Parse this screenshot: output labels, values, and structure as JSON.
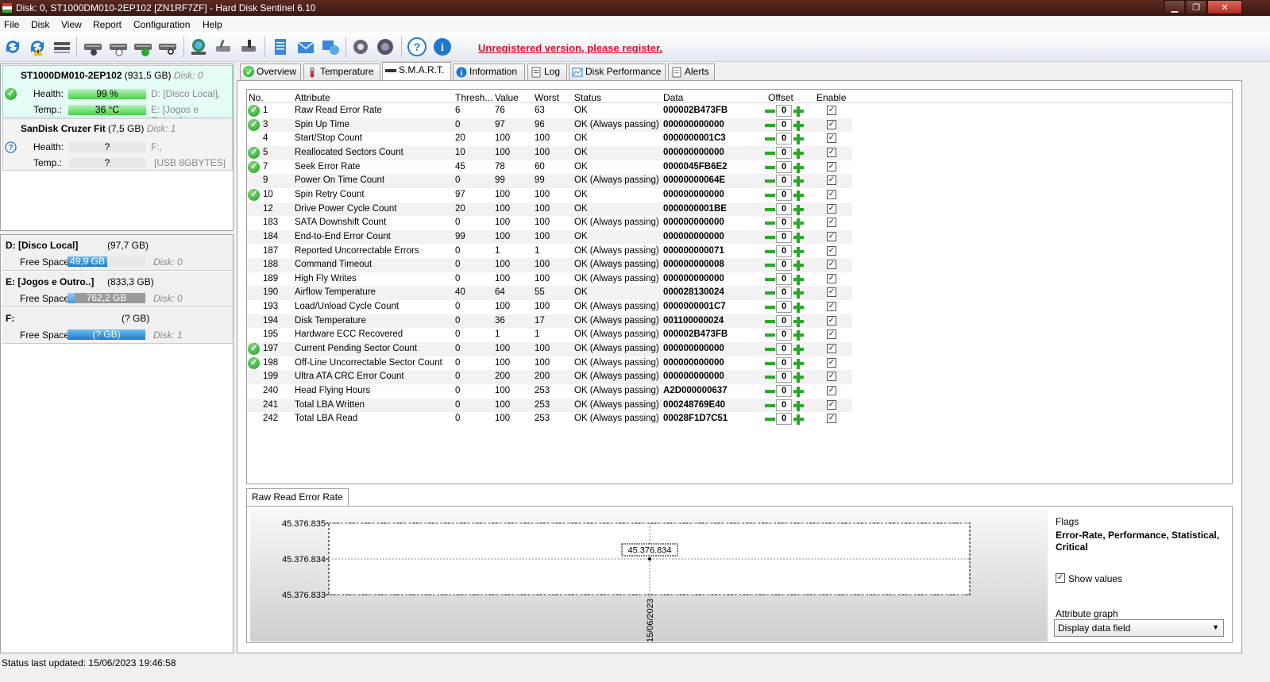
{
  "window": {
    "title": "Disk: 0, ST1000DM010-2EP102 [ZN1RF7ZF]  -  Hard Disk Sentinel 6.10"
  },
  "menu": [
    "File",
    "Disk",
    "View",
    "Report",
    "Configuration",
    "Help"
  ],
  "toolbar": {
    "register_text": "Unregistered version, please register."
  },
  "disks": [
    {
      "name": "ST1000DM010-2EP102",
      "capacity": "(931,5 GB)",
      "disk": "Disk: 0",
      "health_label": "Health:",
      "health": "99 %",
      "health_pct": 99,
      "temp_label": "Temp.:",
      "temp": "36 °C",
      "drive1": "D: [Disco Local],",
      "drive2": "E: [Jogos e Outros],"
    },
    {
      "name": "SanDisk Cruzer Fit",
      "capacity": "(7,5 GB)",
      "disk": "Disk: 1",
      "health_label": "Health:",
      "health": "?",
      "temp_label": "Temp.:",
      "temp": "?",
      "drive1": "F:,",
      "drive2": "[USB 8GBYTES]"
    }
  ],
  "volumes": [
    {
      "name": "D: [Disco Local]",
      "capacity": "(97,7 GB)",
      "free_label": "Free Space",
      "free": "49,9 GB",
      "free_pct": 51,
      "disk": "Disk: 0"
    },
    {
      "name": "E: [Jogos e Outro..]",
      "capacity": "(833,3 GB)",
      "free_label": "Free Space",
      "free": "762,2 GB",
      "free_pct": 9,
      "disk": "Disk: 0"
    },
    {
      "name": "F:",
      "capacity": "(? GB)",
      "free_label": "Free Space",
      "free": "(? GB)",
      "free_pct": 100,
      "disk": "Disk: 1"
    }
  ],
  "tabs": [
    "Overview",
    "Temperature",
    "S.M.A.R.T.",
    "Information",
    "Log",
    "Disk Performance",
    "Alerts"
  ],
  "smart": {
    "headers": {
      "no": "No.",
      "attribute": "Attribute",
      "threshold": "Thresh...",
      "value": "Value",
      "worst": "Worst",
      "status": "Status",
      "data": "Data",
      "offset": "Offset",
      "enable": "Enable"
    },
    "rows": [
      {
        "ok": true,
        "no": "1",
        "attr": "Raw Read Error Rate",
        "th": "6",
        "val": "76",
        "worst": "63",
        "status": "OK",
        "data": "000002B473FB",
        "offset": "0"
      },
      {
        "ok": true,
        "no": "3",
        "attr": "Spin Up Time",
        "th": "0",
        "val": "97",
        "worst": "96",
        "status": "OK (Always passing)",
        "data": "000000000000",
        "offset": "0"
      },
      {
        "ok": false,
        "no": "4",
        "attr": "Start/Stop Count",
        "th": "20",
        "val": "100",
        "worst": "100",
        "status": "OK",
        "data": "0000000001C3",
        "offset": "0"
      },
      {
        "ok": true,
        "no": "5",
        "attr": "Reallocated Sectors Count",
        "th": "10",
        "val": "100",
        "worst": "100",
        "status": "OK",
        "data": "000000000000",
        "offset": "0"
      },
      {
        "ok": true,
        "no": "7",
        "attr": "Seek Error Rate",
        "th": "45",
        "val": "78",
        "worst": "60",
        "status": "OK",
        "data": "0000045FB6E2",
        "offset": "0"
      },
      {
        "ok": false,
        "no": "9",
        "attr": "Power On Time Count",
        "th": "0",
        "val": "99",
        "worst": "99",
        "status": "OK (Always passing)",
        "data": "00000000064E",
        "offset": "0"
      },
      {
        "ok": true,
        "no": "10",
        "attr": "Spin Retry Count",
        "th": "97",
        "val": "100",
        "worst": "100",
        "status": "OK",
        "data": "000000000000",
        "offset": "0"
      },
      {
        "ok": false,
        "no": "12",
        "attr": "Drive Power Cycle Count",
        "th": "20",
        "val": "100",
        "worst": "100",
        "status": "OK",
        "data": "0000000001BE",
        "offset": "0"
      },
      {
        "ok": false,
        "no": "183",
        "attr": "SATA Downshift Count",
        "th": "0",
        "val": "100",
        "worst": "100",
        "status": "OK (Always passing)",
        "data": "000000000000",
        "offset": "0"
      },
      {
        "ok": false,
        "no": "184",
        "attr": "End-to-End Error Count",
        "th": "99",
        "val": "100",
        "worst": "100",
        "status": "OK",
        "data": "000000000000",
        "offset": "0"
      },
      {
        "ok": false,
        "no": "187",
        "attr": "Reported Uncorrectable Errors",
        "th": "0",
        "val": "1",
        "worst": "1",
        "status": "OK (Always passing)",
        "data": "000000000071",
        "offset": "0"
      },
      {
        "ok": false,
        "no": "188",
        "attr": "Command Timeout",
        "th": "0",
        "val": "100",
        "worst": "100",
        "status": "OK (Always passing)",
        "data": "000000000008",
        "offset": "0"
      },
      {
        "ok": false,
        "no": "189",
        "attr": "High Fly Writes",
        "th": "0",
        "val": "100",
        "worst": "100",
        "status": "OK (Always passing)",
        "data": "000000000000",
        "offset": "0"
      },
      {
        "ok": false,
        "no": "190",
        "attr": "Airflow Temperature",
        "th": "40",
        "val": "64",
        "worst": "55",
        "status": "OK",
        "data": "000028130024",
        "offset": "0"
      },
      {
        "ok": false,
        "no": "193",
        "attr": "Load/Unload Cycle Count",
        "th": "0",
        "val": "100",
        "worst": "100",
        "status": "OK (Always passing)",
        "data": "0000000001C7",
        "offset": "0"
      },
      {
        "ok": false,
        "no": "194",
        "attr": "Disk Temperature",
        "th": "0",
        "val": "36",
        "worst": "17",
        "status": "OK (Always passing)",
        "data": "001100000024",
        "offset": "0"
      },
      {
        "ok": false,
        "no": "195",
        "attr": "Hardware ECC Recovered",
        "th": "0",
        "val": "1",
        "worst": "1",
        "status": "OK (Always passing)",
        "data": "000002B473FB",
        "offset": "0"
      },
      {
        "ok": true,
        "no": "197",
        "attr": "Current Pending Sector Count",
        "th": "0",
        "val": "100",
        "worst": "100",
        "status": "OK (Always passing)",
        "data": "000000000000",
        "offset": "0"
      },
      {
        "ok": true,
        "no": "198",
        "attr": "Off-Line Uncorrectable Sector Count",
        "th": "0",
        "val": "100",
        "worst": "100",
        "status": "OK (Always passing)",
        "data": "000000000000",
        "offset": "0"
      },
      {
        "ok": false,
        "no": "199",
        "attr": "Ultra ATA CRC Error Count",
        "th": "0",
        "val": "200",
        "worst": "200",
        "status": "OK (Always passing)",
        "data": "000000000000",
        "offset": "0"
      },
      {
        "ok": false,
        "no": "240",
        "attr": "Head Flying Hours",
        "th": "0",
        "val": "100",
        "worst": "253",
        "status": "OK (Always passing)",
        "data": "A2D000000637",
        "offset": "0"
      },
      {
        "ok": false,
        "no": "241",
        "attr": "Total LBA Written",
        "th": "0",
        "val": "100",
        "worst": "253",
        "status": "OK (Always passing)",
        "data": "000248769E40",
        "offset": "0"
      },
      {
        "ok": false,
        "no": "242",
        "attr": "Total LBA Read",
        "th": "0",
        "val": "100",
        "worst": "253",
        "status": "OK (Always passing)",
        "data": "00028F1D7C51",
        "offset": "0"
      }
    ]
  },
  "graph": {
    "tab_label": "Raw Read Error Rate",
    "flags_label": "Flags",
    "flags_value": "Error-Rate, Performance, Statistical, Critical",
    "show_values_label": "Show values",
    "attribute_graph_label": "Attribute graph",
    "attribute_graph_value": "Display data field"
  },
  "chart_data": {
    "type": "line",
    "x": [
      "15/06/2023"
    ],
    "series": [
      {
        "values": [
          45376834
        ]
      }
    ],
    "y_ticks": [
      "45.376.835",
      "45.376.834",
      "45.376.833"
    ],
    "ylim": [
      45376833,
      45376835
    ],
    "point_labels": [
      "45.376.834"
    ],
    "grid": true
  },
  "status": {
    "text": "Status last updated: 15/06/2023 19:46:58"
  }
}
